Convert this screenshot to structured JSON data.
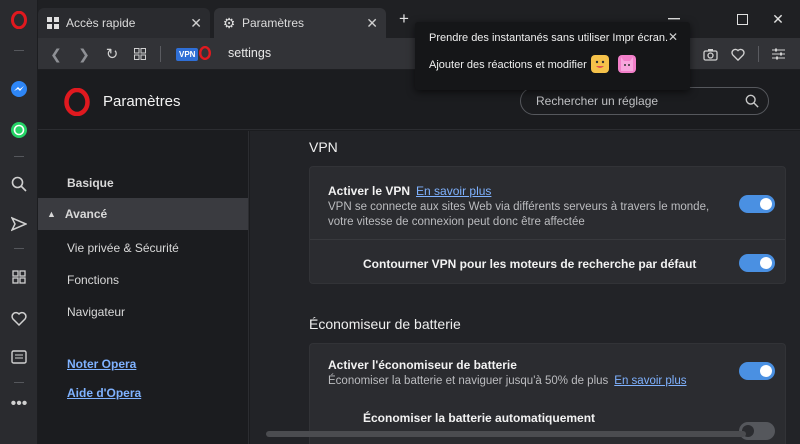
{
  "tabs": [
    {
      "label": "Accès rapide",
      "icon": "grid-icon"
    },
    {
      "label": "Paramètres",
      "icon": "gear-icon"
    }
  ],
  "addressbar": {
    "badge": "VPN",
    "url": "settings"
  },
  "tooltip": {
    "line1": "Prendre des instantanés sans utiliser Impr écran.",
    "line2": "Ajouter des réactions et modifier"
  },
  "header": {
    "title": "Paramètres",
    "search_placeholder": "Rechercher un réglage"
  },
  "nav": {
    "items": [
      {
        "label": "Basique"
      },
      {
        "label": "Avancé"
      },
      {
        "label": "Vie privée & Sécurité"
      },
      {
        "label": "Fonctions"
      },
      {
        "label": "Navigateur"
      }
    ],
    "links": [
      {
        "label": "Noter Opera"
      },
      {
        "label": "Aide d'Opera"
      }
    ]
  },
  "vpn": {
    "title": "VPN",
    "enable_label": "Activer le VPN",
    "learn_more": "En savoir plus",
    "description": "VPN se connecte aux sites Web via différents serveurs à travers le monde, votre vitesse de connexion peut donc être affectée",
    "bypass_label": "Contourner VPN pour les moteurs de recherche par défaut",
    "enabled": true,
    "bypass_enabled": true
  },
  "battery": {
    "title": "Économiseur de batterie",
    "enable_label": "Activer l'économiseur de batterie",
    "description": "Économiser la batterie et naviguer jusqu'à 50% de plus",
    "learn_more": "En savoir plus",
    "auto_label": "Économiser la batterie automatiquement",
    "enabled": true,
    "auto_enabled": false
  },
  "colors": {
    "accent": "#4a90e2",
    "link": "#7fb2ff",
    "opera_red": "#e0191f"
  }
}
